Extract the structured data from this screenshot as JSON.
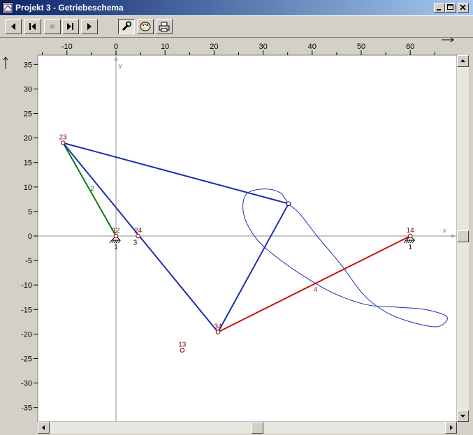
{
  "window": {
    "title": "Projekt 3 - Getriebeschema"
  },
  "toolbar": {
    "buttons": [
      "first",
      "previous",
      "stop",
      "last",
      "play",
      "tools",
      "colors",
      "print"
    ],
    "stop_disabled": true,
    "tools_pressed": true
  },
  "chart_data": {
    "type": "mechanism-diagram",
    "x_range": [
      -16,
      69
    ],
    "y_range": [
      -38,
      37
    ],
    "x_ticks": [
      -10,
      0,
      10,
      20,
      30,
      40,
      50,
      60
    ],
    "y_ticks": [
      35,
      30,
      25,
      20,
      15,
      10,
      5,
      0,
      -5,
      -10,
      -15,
      -20,
      -25,
      -30,
      -35
    ],
    "x_axis_label": "x",
    "y_axis_label": "y",
    "joints": [
      {
        "label": "23",
        "x": -10.8,
        "y": 19.0,
        "color": "#8b0000"
      },
      {
        "label": "12",
        "x": 0,
        "y": 0,
        "color": "#8b0000",
        "ground": true,
        "ground_label": "1"
      },
      {
        "label": "24",
        "x": 4.5,
        "y": 0,
        "color": "#8b0000"
      },
      {
        "label": "34",
        "x": 20.8,
        "y": -19.6,
        "color": "#8b0000"
      },
      {
        "label": "14",
        "x": 60,
        "y": 0,
        "color": "#8b0000",
        "ground": true,
        "ground_label": "1"
      },
      {
        "label": "13",
        "x": 13.5,
        "y": -23.3,
        "color": "#8b0000"
      },
      {
        "label": "",
        "x": 35.2,
        "y": 6.6,
        "color": "#00008b"
      }
    ],
    "links": [
      {
        "label": "2",
        "color": "#117711",
        "points": [
          [
            0,
            0
          ],
          [
            -10.8,
            19.0
          ]
        ],
        "label_at": [
          -4.8,
          9.8
        ]
      },
      {
        "label": "3",
        "color": "#1a2fb0",
        "points": [
          [
            -10.8,
            19.0
          ],
          [
            35.2,
            6.6
          ],
          [
            20.8,
            -19.6
          ],
          [
            -10.8,
            19.0
          ]
        ],
        "label_at": [
          3.9,
          -1.2
        ]
      },
      {
        "label": "4",
        "color": "#cc1111",
        "points": [
          [
            20.8,
            -19.6
          ],
          [
            60,
            0
          ]
        ],
        "label_at": [
          40.7,
          -10.8
        ]
      }
    ],
    "coupler_curve": {
      "color": "#1a2fb0",
      "points": [
        [
          35.2,
          6.6
        ],
        [
          33.5,
          8.8
        ],
        [
          30.5,
          9.6
        ],
        [
          27.0,
          8.9
        ],
        [
          25.9,
          6.6
        ],
        [
          26.5,
          3.0
        ],
        [
          29.0,
          -1.0
        ],
        [
          33.0,
          -4.5
        ],
        [
          38.0,
          -8.0
        ],
        [
          44.0,
          -11.5
        ],
        [
          51.0,
          -14.0
        ],
        [
          57.0,
          -14.5
        ],
        [
          63.0,
          -15.0
        ],
        [
          67.5,
          -16.5
        ],
        [
          65.5,
          -18.5
        ],
        [
          60.0,
          -17.5
        ],
        [
          55.0,
          -15.5
        ],
        [
          50.5,
          -12.0
        ],
        [
          46.0,
          -6.0
        ],
        [
          41.0,
          0.0
        ],
        [
          37.5,
          4.5
        ],
        [
          35.2,
          6.6
        ]
      ]
    }
  }
}
